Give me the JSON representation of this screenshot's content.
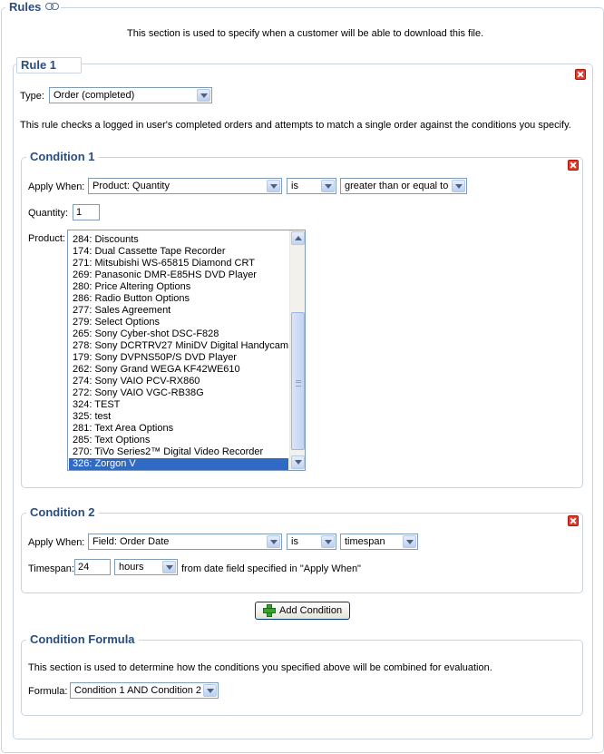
{
  "rules": {
    "legend": "Rules",
    "description": "This section is used to specify when a customer will be able to download this file."
  },
  "rule1": {
    "legend": "Rule 1",
    "type_label": "Type:",
    "type_value": "Order (completed)",
    "description": "This rule checks a logged in user's completed orders and attempts to match a single order against the conditions you specify."
  },
  "condition1": {
    "legend": "Condition 1",
    "apply_when_label": "Apply When:",
    "apply_when_value": "Product: Quantity",
    "operator_value": "is",
    "comparison_value": "greater than or equal to",
    "quantity_label": "Quantity:",
    "quantity_value": "1",
    "product_label": "Product:",
    "products": [
      "284: Discounts",
      "174: Dual Cassette Tape Recorder",
      "271: Mitsubishi WS-65815 Diamond CRT",
      "269: Panasonic DMR-E85HS DVD Player",
      "280: Price Altering Options",
      "286: Radio Button Options",
      "277: Sales Agreement",
      "279: Select Options",
      "265: Sony Cyber-shot DSC-F828",
      "278: Sony DCRTRV27 MiniDV Digital Handycam",
      "179: Sony DVPNS50P/S DVD Player",
      "262: Sony Grand WEGA KF42WE610",
      "274: Sony VAIO PCV-RX860",
      "272: Sony VAIO VGC-RB38G",
      "324: TEST",
      "325: test",
      "281: Text Area Options",
      "285: Text Options",
      "270: TiVo Series2™ Digital Video Recorder",
      "326: Zorgon V"
    ],
    "selected_product": "326: Zorgon V"
  },
  "condition2": {
    "legend": "Condition 2",
    "apply_when_label": "Apply When:",
    "apply_when_value": "Field: Order Date",
    "operator_value": "is",
    "comparison_value": "timespan",
    "timespan_label": "Timespan:",
    "timespan_value": "24",
    "unit_value": "hours",
    "suffix_text": "from date field specified in \"Apply When\""
  },
  "add_condition_label": "Add Condition",
  "formula_section": {
    "legend": "Condition Formula",
    "description": "This section is used to determine how the conditions you specified above will be combined for evaluation.",
    "formula_label": "Formula:",
    "formula_value": "Condition 1 AND Condition 2"
  },
  "colors": {
    "legend_text": "#2a4d80",
    "fieldset_border": "#c9d3e2",
    "selection": "#316ac5",
    "delete_icon": "#e33b2a"
  }
}
